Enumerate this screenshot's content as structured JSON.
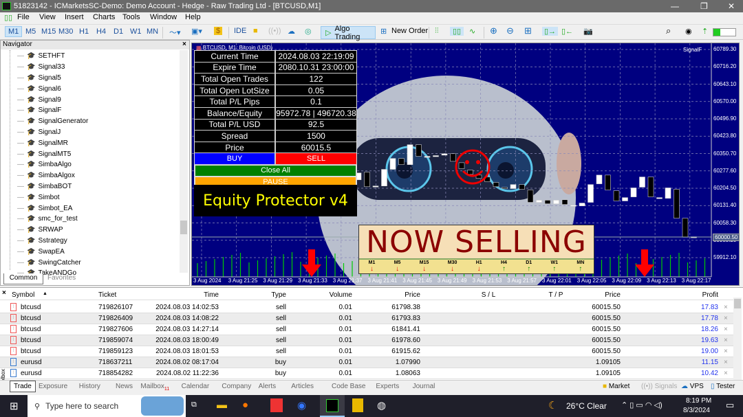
{
  "window": {
    "title": "51823142 - ICMarketsSC-Demo: Demo Account - Hedge - Raw Trading Ltd - [BTCUSD,M1]"
  },
  "menu": [
    "File",
    "View",
    "Insert",
    "Charts",
    "Tools",
    "Window",
    "Help"
  ],
  "toolbar": {
    "timeframes": [
      "M1",
      "M5",
      "M15",
      "M30",
      "H1",
      "H4",
      "D1",
      "W1",
      "MN"
    ],
    "active_timeframe": "M1",
    "ide": "IDE",
    "algo_trading": "Algo Trading",
    "new_order": "New Order"
  },
  "navigator": {
    "title": "Navigator",
    "items": [
      "SETHFT",
      "Signal33",
      "Signal5",
      "Signal6",
      "Signal9",
      "SignalF",
      "SignalGenerator",
      "SignalJ",
      "SignalMR",
      "SignalMT5",
      "SimbaAlgo",
      "SimbaAlgox",
      "SimbaBOT",
      "Simbot",
      "Simbot_EA",
      "smc_for_test",
      "SRWAP",
      "Sstrategy",
      "SwapEA",
      "SwingCatcher",
      "TakeANDGo"
    ],
    "tabs": [
      "Common",
      "Favorites"
    ]
  },
  "chart": {
    "header": "BTCUSD, M1: Bitcoin (USD)",
    "ea_label": "SignalF",
    "background": "#000080",
    "price_labels": [
      "60789.30",
      "60716.20",
      "60643.10",
      "60570.00",
      "60496.90",
      "60423.80",
      "60350.70",
      "60277.60",
      "60204.50",
      "60131.40",
      "60058.30",
      "59985.20",
      "59912.10"
    ],
    "current_price": "60000.50",
    "time_labels": [
      "3 Aug 2024",
      "3 Aug 21:25",
      "3 Aug 21:29",
      "3 Aug 21:33",
      "3 Aug 21:37",
      "3 Aug 21:41",
      "3 Aug 21:45",
      "3 Aug 21:49",
      "3 Aug 21:53",
      "3 Aug 21:57",
      "3 Aug 22:01",
      "3 Aug 22:05",
      "3 Aug 22:09",
      "3 Aug 22:13",
      "3 Aug 22:17"
    ],
    "candles_open_close": [
      [
        60240,
        60269
      ],
      [
        60272,
        60211
      ],
      [
        60214,
        60214
      ],
      [
        60214,
        60284
      ],
      [
        60284,
        60330
      ],
      [
        60330,
        60304
      ],
      [
        60304,
        60388
      ],
      [
        60388,
        60339
      ],
      [
        60339,
        60339
      ],
      [
        60342,
        60342
      ],
      [
        60344,
        60350
      ],
      [
        60350,
        60318
      ],
      [
        60312,
        60287
      ],
      [
        60281,
        60263
      ],
      [
        60260,
        60246
      ],
      [
        60252,
        60232
      ],
      [
        60229,
        60211
      ],
      [
        60208,
        60203
      ],
      [
        60203,
        60220
      ],
      [
        60220,
        60200
      ],
      [
        60197,
        60145
      ],
      [
        60145,
        60154
      ],
      [
        60154,
        60139
      ],
      [
        60139,
        60154
      ],
      [
        60156,
        60136
      ],
      [
        60133,
        60133
      ],
      [
        60130,
        60142
      ],
      [
        60145,
        60220
      ],
      [
        60223,
        60260
      ],
      [
        60260,
        60197
      ],
      [
        60194,
        60151
      ],
      [
        60151,
        60165
      ],
      [
        60168,
        60206
      ],
      [
        60209,
        60252
      ],
      [
        60252,
        60168
      ],
      [
        60165,
        60165
      ],
      [
        60162,
        60206
      ],
      [
        60200,
        60078
      ],
      [
        60078,
        59998
      ],
      [
        60000,
        60000
      ]
    ]
  },
  "panel": {
    "rows": [
      {
        "label": "Current Time",
        "value": "2024.08.03 22:19:09"
      },
      {
        "label": "Expire Time",
        "value": "2080.10.31 23:00:00"
      },
      {
        "label": "Total Open Trades",
        "value": "122"
      },
      {
        "label": "Total Open LotSize",
        "value": "0.05"
      },
      {
        "label": "Total P/L Pips",
        "value": "0.1"
      },
      {
        "label": "Balance/Equity",
        "value": "95972.78 | 496720.38"
      },
      {
        "label": "Total P/L USD",
        "value": "92.5"
      },
      {
        "label": "Spread",
        "value": "1500"
      },
      {
        "label": "Price",
        "value": "60015.5"
      }
    ],
    "buy": "BUY",
    "sell": "SELL",
    "close_all": "Close All",
    "pause": "PAUSE",
    "title": "Equity Protector v4",
    "colors": {
      "buy": "#0000ff",
      "sell": "#ff0000",
      "close_all": "#008000",
      "pause": "#ffa500",
      "title": "#ffff00"
    }
  },
  "banner": {
    "text": "NOW SELLING",
    "timeframes": [
      {
        "tf": "M1",
        "dir": "down"
      },
      {
        "tf": "M5",
        "dir": "down"
      },
      {
        "tf": "M15",
        "dir": "down"
      },
      {
        "tf": "M30",
        "dir": "down"
      },
      {
        "tf": "H1",
        "dir": "down"
      },
      {
        "tf": "H4",
        "dir": "up"
      },
      {
        "tf": "D1",
        "dir": "up"
      },
      {
        "tf": "W1",
        "dir": "up"
      },
      {
        "tf": "MN",
        "dir": "up"
      }
    ]
  },
  "toolbox": {
    "label": "Toolbox",
    "columns": [
      "Symbol",
      "Ticket",
      "Time",
      "Type",
      "Volume",
      "Price",
      "S / L",
      "T / P",
      "Price",
      "Profit"
    ],
    "rows": [
      [
        "btcusd",
        "719826107",
        "2024.08.03 14:02:53",
        "sell",
        "0.01",
        "61798.38",
        "",
        "",
        "60015.50",
        "17.83"
      ],
      [
        "btcusd",
        "719826409",
        "2024.08.03 14:08:22",
        "sell",
        "0.01",
        "61793.83",
        "",
        "",
        "60015.50",
        "17.78"
      ],
      [
        "btcusd",
        "719827606",
        "2024.08.03 14:27:14",
        "sell",
        "0.01",
        "61841.41",
        "",
        "",
        "60015.50",
        "18.26"
      ],
      [
        "btcusd",
        "719859074",
        "2024.08.03 18:00:49",
        "sell",
        "0.01",
        "61978.60",
        "",
        "",
        "60015.50",
        "19.63"
      ],
      [
        "btcusd",
        "719859123",
        "2024.08.03 18:01:53",
        "sell",
        "0.01",
        "61915.62",
        "",
        "",
        "60015.50",
        "19.00"
      ],
      [
        "eurusd",
        "718637211",
        "2024.08.02 08:17:04",
        "buy",
        "0.01",
        "1.07990",
        "",
        "",
        "1.09105",
        "11.15"
      ],
      [
        "eurusd",
        "718854282",
        "2024.08.02 11:22:36",
        "buy",
        "0.01",
        "1.08063",
        "",
        "",
        "1.09105",
        "10.42"
      ]
    ],
    "tabs": [
      "Trade",
      "Exposure",
      "History",
      "News",
      "Mailbox",
      "Calendar",
      "Company",
      "Alerts",
      "Articles",
      "Code Base",
      "Experts",
      "Journal"
    ],
    "mailbox_badge": "11",
    "right": [
      "Market",
      "Signals",
      "VPS",
      "Tester"
    ]
  },
  "taskbar": {
    "search_placeholder": "Type here to search",
    "weather": "26°C  Clear",
    "time": "8:19 PM",
    "date": "8/3/2024"
  }
}
